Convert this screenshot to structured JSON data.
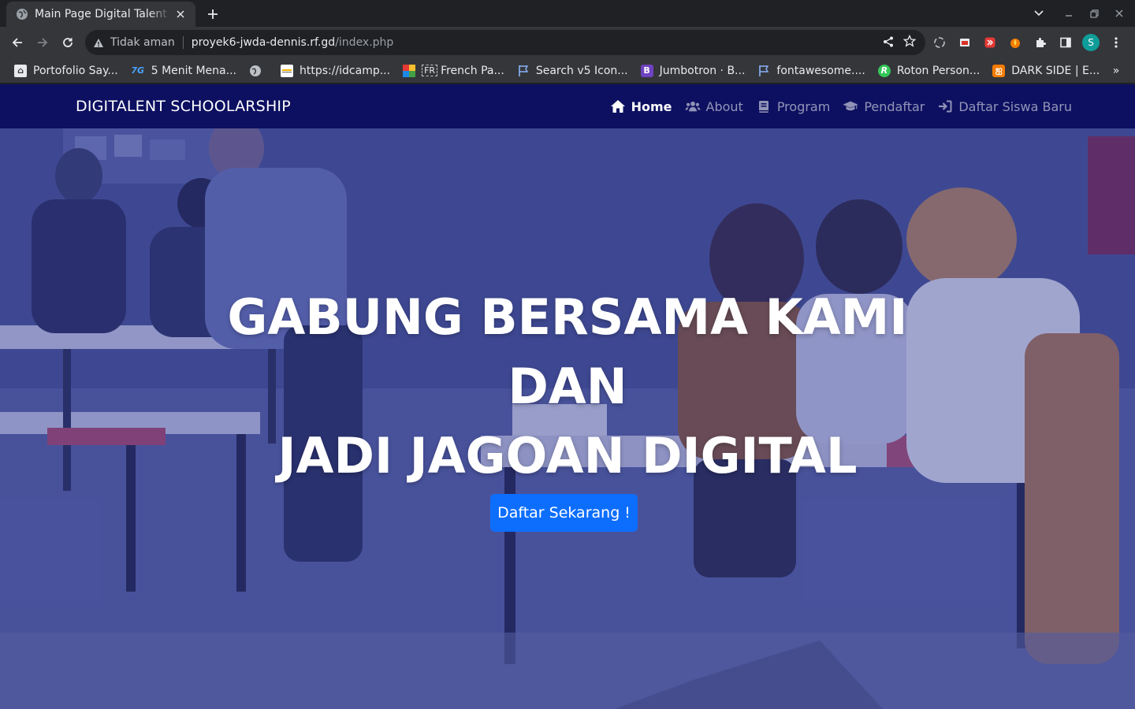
{
  "browser": {
    "tab": {
      "title": "Main Page Digital Talent Scholarship"
    },
    "omnibox": {
      "security_label": "Tidak aman",
      "url_host": "proyek6-jwda-dennis.rf.gd",
      "url_path": "/index.php"
    },
    "profile_initial": "S",
    "bookmarks": [
      {
        "label": "Portofolio Say...",
        "icon": "portfolio-icon"
      },
      {
        "label": "5 Menit Mena...",
        "icon": "7g-icon"
      },
      {
        "label": "",
        "icon": "globe-icon"
      },
      {
        "label": "https://idcamp...",
        "icon": "idcamp-icon"
      },
      {
        "label": "French Pa...",
        "icon": "colorful-grid-icon"
      },
      {
        "label": "Search v5 Icon...",
        "icon": "flag-icon"
      },
      {
        "label": "Jumbotron · B...",
        "icon": "bootstrap-icon"
      },
      {
        "label": "fontawesome....",
        "icon": "flag-icon"
      },
      {
        "label": "Roton Person...",
        "icon": "roton-icon"
      },
      {
        "label": "DARK SIDE | E...",
        "icon": "darkside-icon"
      }
    ],
    "bookmarks_overflow": "»"
  },
  "site": {
    "brand": "DIGITALENT SCHOOLARSHIP",
    "nav": [
      {
        "label": "Home",
        "icon": "home-icon",
        "active": true
      },
      {
        "label": "About",
        "icon": "users-icon",
        "active": false
      },
      {
        "label": "Program",
        "icon": "book-icon",
        "active": false
      },
      {
        "label": "Pendaftar",
        "icon": "graduation-cap-icon",
        "active": false
      },
      {
        "label": "Daftar Siswa Baru",
        "icon": "sign-in-icon",
        "active": false
      }
    ],
    "hero": {
      "line1": "GABUNG BERSAMA KAMI",
      "line2": "DAN",
      "line3": "JADI JAGOAN DIGITAL",
      "cta": "Daftar Sekarang !"
    }
  },
  "colors": {
    "navbar": "#0d1060",
    "cta": "#0d6efd",
    "hero_tint": "#3f4a8a"
  }
}
